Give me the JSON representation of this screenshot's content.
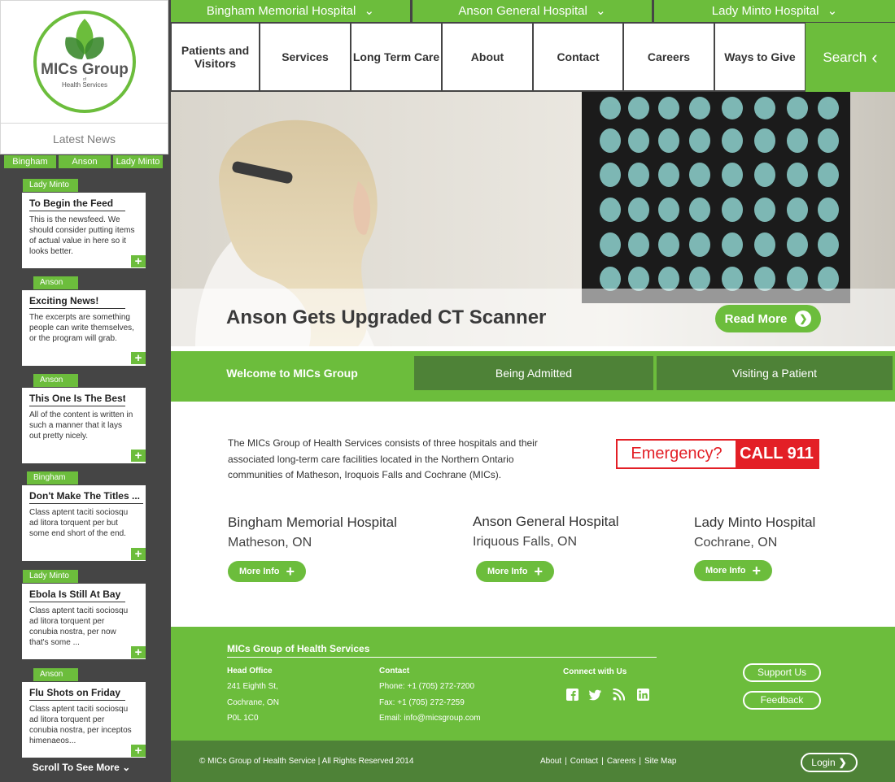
{
  "brand": {
    "name": "MICs Group",
    "of": "of",
    "tagline": "Health Services"
  },
  "sidebar": {
    "latest_news": "Latest News",
    "filters": [
      "Bingham",
      "Anson",
      "Lady Minto"
    ],
    "news": [
      {
        "tag": "Lady Minto",
        "title": "To Begin the Feed",
        "excerpt": "This is the newsfeed. We should consider putting items of actual value in here so it looks better."
      },
      {
        "tag": "Anson",
        "title": "Exciting News!",
        "excerpt": "The excerpts are something people can write themselves, or the program will grab."
      },
      {
        "tag": "Anson",
        "title": "This One Is The Best",
        "excerpt": "All of the content is written in such a manner that it lays out pretty nicely."
      },
      {
        "tag": "Bingham",
        "title": "Don't Make The Titles ...",
        "excerpt": "Class aptent taciti sociosqu ad litora torquent per but some end short of the end."
      },
      {
        "tag": "Lady Minto",
        "title": "Ebola Is Still At Bay",
        "excerpt": "Class aptent taciti sociosqu ad litora torquent per conubia nostra, per now that's some ..."
      },
      {
        "tag": "Anson",
        "title": "Flu Shots on Friday",
        "excerpt": "Class aptent taciti sociosqu ad litora torquent per conubia nostra, per inceptos himenaeos..."
      }
    ],
    "plus": "+",
    "scroll_more": "Scroll To See More"
  },
  "hospital_bar": [
    "Bingham Memorial Hospital",
    "Anson General Hospital",
    "Lady Minto Hospital"
  ],
  "nav": {
    "items": [
      "Patients and Visitors",
      "Services",
      "Long Term Care",
      "About",
      "Contact",
      "Careers",
      "Ways to Give"
    ],
    "search": "Search"
  },
  "hero": {
    "title": "Anson Gets Upgraded CT Scanner",
    "read_more": "Read More"
  },
  "tabs": [
    "Welcome to MICs Group",
    "Being Admitted",
    "Visiting a Patient"
  ],
  "intro": "The MICs Group of Health Services consists of three hospitals and their associated long-term care facilities located in the Northern Ontario communities of Matheson, Iroquois Falls and Cochrane (MICs).",
  "emergency": {
    "question": "Emergency?",
    "call": "CALL 911"
  },
  "hospitals": [
    {
      "name": "Bingham Memorial Hospital",
      "city": "Matheson, ON",
      "button": "More Info"
    },
    {
      "name": "Anson General Hospital",
      "city": "Iriquous Falls, ON",
      "button": "More Info"
    },
    {
      "name": "Lady Minto Hospital",
      "city": "Cochrane, ON",
      "button": "More Info"
    }
  ],
  "footer": {
    "org": "MICs Group of Health Services",
    "head_office_label": "Head Office",
    "address": [
      "241 Eighth St,",
      "Cochrane, ON",
      "P0L 1C0"
    ],
    "contact_label": "Contact",
    "contact": [
      "Phone: +1 (705) 272-7200",
      "Fax: +1 (705) 272-7259",
      "Email: info@micsgroup.com"
    ],
    "connect_label": "Connect with Us",
    "support": "Support Us",
    "feedback": "Feedback",
    "copyright": "© MICs Group of Health Service  |  All Rights Reserved  2014",
    "links": [
      "About",
      "Contact",
      "Careers",
      "Site Map"
    ],
    "separator": "|",
    "login": "Login"
  },
  "colors": {
    "accent": "#6cbd3c",
    "dark": "#454545",
    "footer_dark": "#4e8237",
    "emergency": "#e31f26"
  }
}
